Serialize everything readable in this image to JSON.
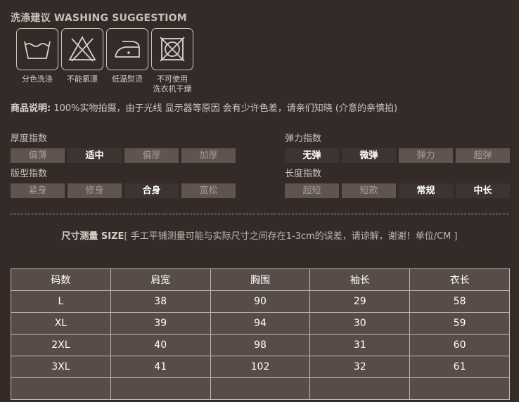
{
  "title": "洗涤建议 WASHING SUGGESTIOM",
  "wash_icons": [
    {
      "icon": "wash-basin-icon",
      "label": "分色洗涤"
    },
    {
      "icon": "no-bleach-icon",
      "label": "不能氯漂"
    },
    {
      "icon": "low-iron-icon",
      "label": "低温熨烫"
    },
    {
      "icon": "no-tumble-dry-icon",
      "label": "不可使用\n洗衣机干燥"
    }
  ],
  "note": {
    "label": "商品说明:",
    "text": " 100%实物拍摄，由于光线 显示器等原因 会有少许色差，请亲们知晓 (介意的亲慎拍)"
  },
  "indices": {
    "thickness": {
      "title": "厚度指数",
      "options": [
        "偏薄",
        "适中",
        "偏厚",
        "加厚"
      ],
      "selected": 1
    },
    "elasticity": {
      "title": "弹力指数",
      "options": [
        "无弹",
        "微弹",
        "弹力",
        "超弹"
      ],
      "selected": [
        0,
        1
      ]
    },
    "fit": {
      "title": "版型指数",
      "options": [
        "紧身",
        "修身",
        "合身",
        "宽松"
      ],
      "selected": 2
    },
    "length": {
      "title": "长度指数",
      "options": [
        "超短",
        "短款",
        "常规",
        "中长"
      ],
      "selected": [
        2,
        3
      ]
    }
  },
  "size_note": {
    "label": "尺寸测量 SIZE",
    "text": "[ 手工平铺测量可能与实际尺寸之间存在1-3cm的误差，请谅解，谢谢！单位/CM ]"
  },
  "size_table": {
    "headers": [
      "码数",
      "肩宽",
      "胸围",
      "袖长",
      "衣长"
    ],
    "rows": [
      [
        "L",
        "38",
        "90",
        "29",
        "58"
      ],
      [
        "XL",
        "39",
        "94",
        "30",
        "59"
      ],
      [
        "2XL",
        "40",
        "98",
        "31",
        "60"
      ],
      [
        "3XL",
        "41",
        "102",
        "32",
        "61"
      ],
      [
        "",
        "",
        "",
        "",
        ""
      ]
    ]
  }
}
